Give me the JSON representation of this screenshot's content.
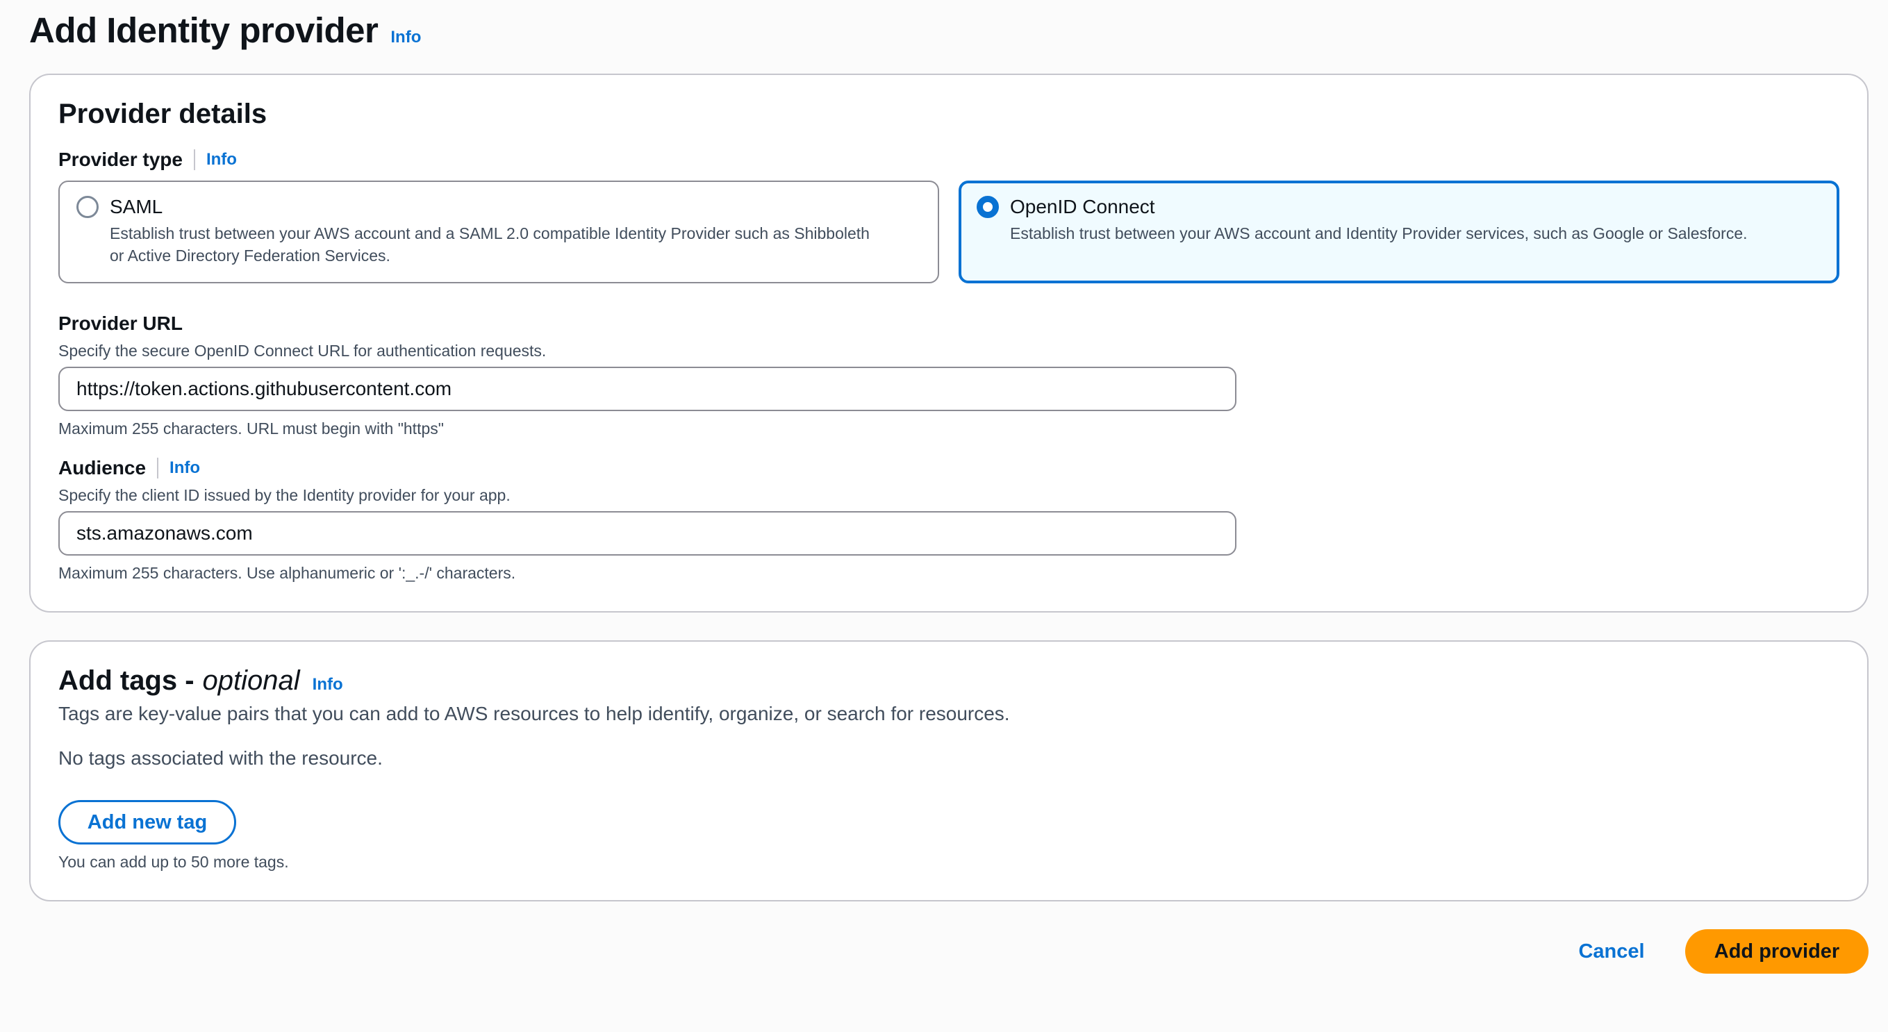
{
  "header": {
    "title": "Add Identity provider",
    "info": "Info"
  },
  "provider_details": {
    "title": "Provider details",
    "provider_type": {
      "label": "Provider type",
      "info": "Info",
      "options": [
        {
          "title": "SAML",
          "description": "Establish trust between your AWS account and a SAML 2.0 compatible Identity Provider such as Shibboleth or Active Directory Federation Services.",
          "selected": false
        },
        {
          "title": "OpenID Connect",
          "description": "Establish trust between your AWS account and Identity Provider services, such as Google or Salesforce.",
          "selected": true
        }
      ]
    },
    "provider_url": {
      "label": "Provider URL",
      "description": "Specify the secure OpenID Connect URL for authentication requests.",
      "value": "https://token.actions.githubusercontent.com",
      "constraint": "Maximum 255 characters. URL must begin with \"https\""
    },
    "audience": {
      "label": "Audience",
      "info": "Info",
      "description": "Specify the client ID issued by the Identity provider for your app.",
      "value": "sts.amazonaws.com",
      "constraint": "Maximum 255 characters. Use alphanumeric or ':_.-/' characters."
    }
  },
  "tags": {
    "title": "Add tags -",
    "title_optional": "optional",
    "info": "Info",
    "description": "Tags are key-value pairs that you can add to AWS resources to help identify, organize, or search for resources.",
    "empty": "No tags associated with the resource.",
    "add_button": "Add new tag",
    "hint": "You can add up to 50 more tags."
  },
  "actions": {
    "cancel": "Cancel",
    "submit": "Add provider"
  },
  "colors": {
    "accent": "#0972d3",
    "primary_button": "#ff9900",
    "selected_tile_bg": "#f0fbff"
  }
}
